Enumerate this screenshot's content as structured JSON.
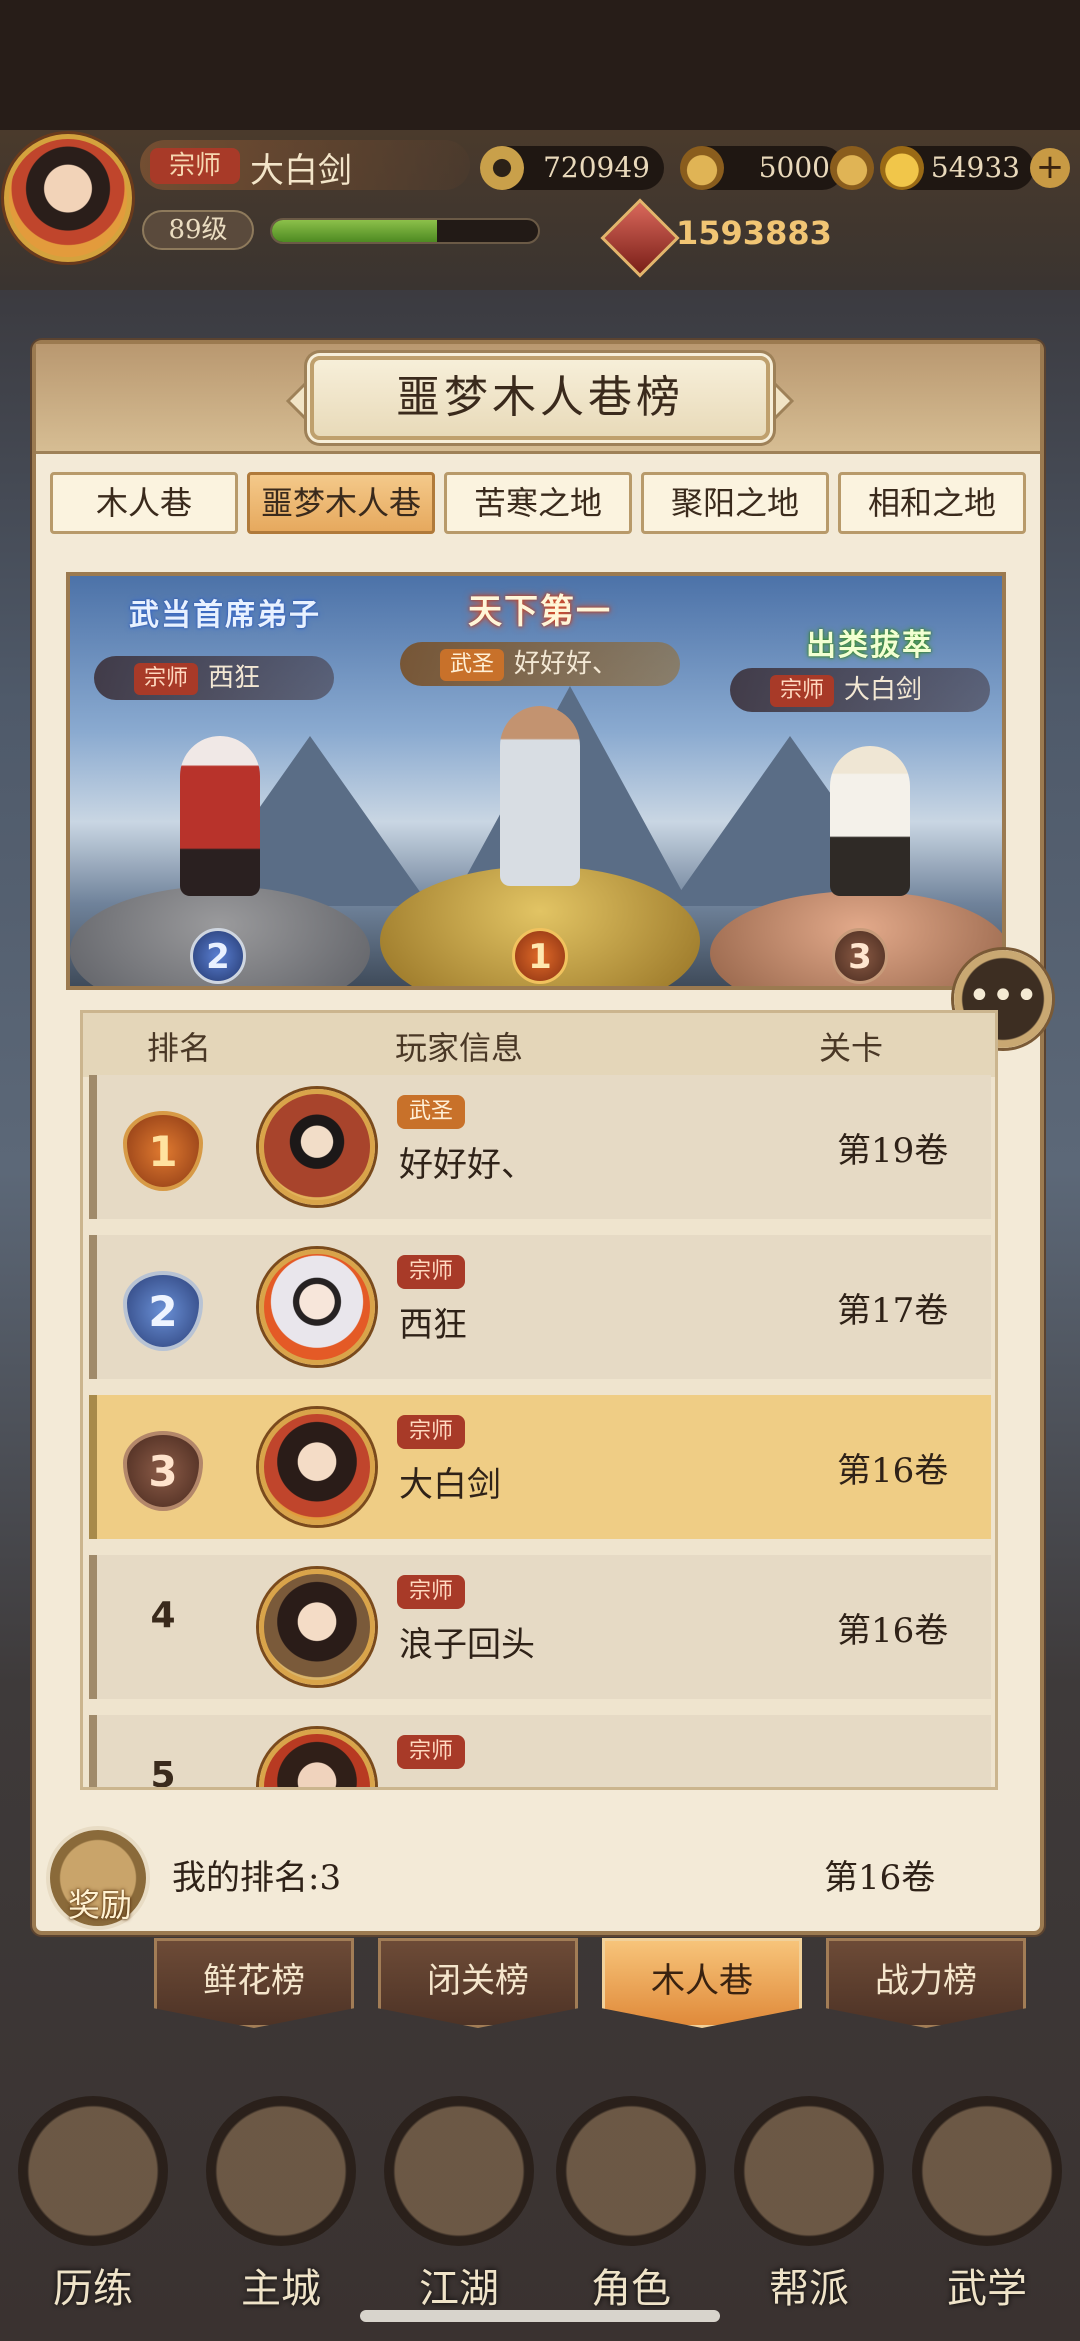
{
  "hud": {
    "rank_title": "宗师",
    "player_name": "大白剑",
    "level": "89级",
    "exp_fraction": 0.62,
    "coins": "720949",
    "ingots": "5000",
    "gold": "54933",
    "add_symbol": "+",
    "power": "1593883"
  },
  "panel": {
    "title": "噩梦木人巷榜",
    "tabs": [
      "木人巷",
      "噩梦木人巷",
      "苦寒之地",
      "聚阳之地",
      "相和之地"
    ],
    "active_tab_index": 1
  },
  "podium": {
    "second": {
      "badge": "武当首席弟子",
      "tag": "宗师",
      "name": "西狂",
      "rank": "2"
    },
    "first": {
      "badge": "天下第一",
      "tag": "武圣",
      "name": "好好好、",
      "rank": "1"
    },
    "third": {
      "badge": "出类拔萃",
      "tag": "宗师",
      "name": "大白剑",
      "rank": "3"
    }
  },
  "chat_icon": "chat-bubble-icon",
  "list": {
    "headers": {
      "rank": "排名",
      "player": "玩家信息",
      "stage": "关卡"
    },
    "rows": [
      {
        "rank": "1",
        "tag": "武圣",
        "name": "好好好、",
        "stage": "第19卷"
      },
      {
        "rank": "2",
        "tag": "宗师",
        "name": "西狂",
        "stage": "第17卷"
      },
      {
        "rank": "3",
        "tag": "宗师",
        "name": "大白剑",
        "stage": "第16卷"
      },
      {
        "rank": "4",
        "tag": "宗师",
        "name": "浪子回头",
        "stage": "第16卷"
      },
      {
        "rank": "5",
        "tag": "宗师",
        "name": "",
        "stage": ""
      }
    ]
  },
  "footer": {
    "reward_label": "奖励",
    "my_rank": "我的排名:3",
    "my_stage": "第16卷"
  },
  "board_tabs": [
    "鲜花榜",
    "闭关榜",
    "木人巷",
    "战力榜"
  ],
  "board_tabs_active": 2,
  "nav": [
    "历练",
    "主城",
    "江湖",
    "角色",
    "帮派",
    "武学"
  ],
  "colors": {
    "accent": "#e6a95e",
    "panel": "#f3ead7",
    "highlight_row": "#efcd85",
    "tag_red": "#a83a28",
    "tag_orange": "#c8712a"
  }
}
